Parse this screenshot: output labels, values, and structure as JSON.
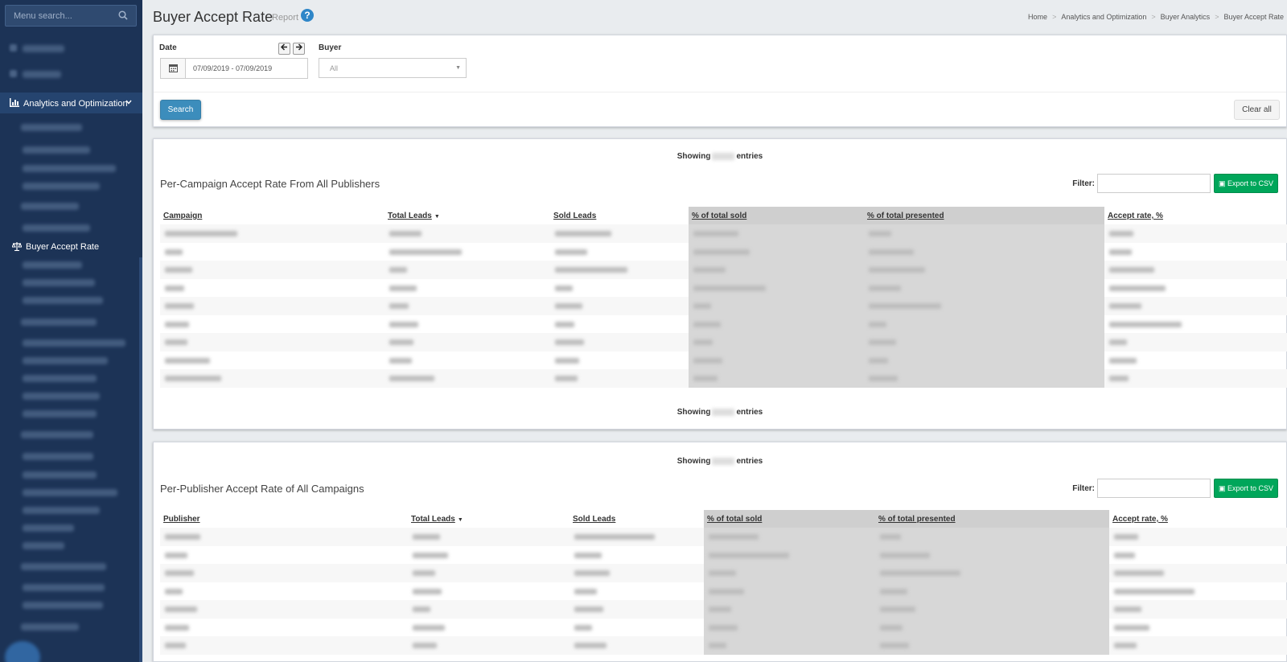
{
  "sidebar": {
    "search_placeholder": "Menu search...",
    "section_label": "Analytics and Optimization",
    "active_item": "Buyer Accept Rate"
  },
  "header": {
    "title": "Buyer Accept Rate",
    "subtitle": "Report",
    "help": "?"
  },
  "breadcrumb": {
    "items": [
      "Home",
      "Analytics and Optimization",
      "Buyer Analytics",
      "Buyer Accept Rate"
    ],
    "separator": ">"
  },
  "filters": {
    "date_label": "Date",
    "date_value": "07/09/2019 - 07/09/2019",
    "buyer_label": "Buyer",
    "buyer_value": "All",
    "search_button": "Search",
    "clear_button": "Clear all"
  },
  "campaign_report": {
    "showing_prefix": "Showing",
    "showing_suffix": "entries",
    "title": "Per-Campaign Accept Rate From All Publishers",
    "filter_label": "Filter:",
    "export_label": "Export to CSV",
    "columns": [
      "Campaign",
      "Total Leads",
      "Sold Leads",
      "% of total sold",
      "% of total presented",
      "Accept rate, %"
    ],
    "row_count": 9
  },
  "publisher_report": {
    "showing_prefix": "Showing",
    "showing_suffix": "entries",
    "title": "Per-Publisher Accept Rate of All Campaigns",
    "filter_label": "Filter:",
    "export_label": "Export to CSV",
    "columns": [
      "Publisher",
      "Total Leads",
      "Sold Leads",
      "% of total sold",
      "% of total presented",
      "Accept rate, %"
    ],
    "row_count": 7
  },
  "colors": {
    "sidebar_bg": "#1c3356",
    "primary_button": "#3c8dbc",
    "export_button": "#00a65a",
    "help_icon": "#2e86c8"
  }
}
